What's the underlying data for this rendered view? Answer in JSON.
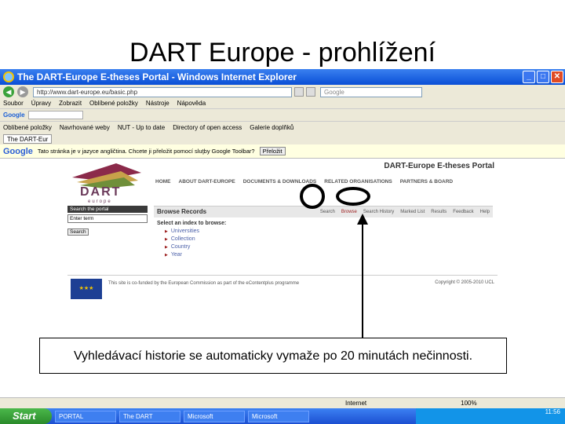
{
  "slide": {
    "title": "DART Europe - prohlížení"
  },
  "browser": {
    "window_title": "The DART-Europe E-theses Portal - Windows Internet Explorer",
    "address": "http://www.dart-europe.eu/basic.php",
    "search_placeholder": "Google",
    "menu": [
      "Soubor",
      "Úpravy",
      "Zobrazit",
      "Oblíbené položky",
      "Nástroje",
      "Nápověda"
    ],
    "google_label": "Google",
    "favorites": [
      "Oblíbené položky",
      "Navrhované weby",
      "NUT - Up to date",
      "Directory of open access",
      "Galerie doplňků"
    ],
    "tab_label": "The DART-Eur",
    "translate_text": "Tato stránka je v jazyce angličtina. Chcete ji přeložit pomocí sluţby Google Toolbar?",
    "translate_button": "Přeložit",
    "google_bar_text": "Google",
    "status_text": "Internet",
    "zoom": "100%"
  },
  "portal": {
    "logo_text": "DART",
    "logo_sub": "europe",
    "title": "DART-Europe E-theses Portal",
    "topnav": [
      "HOME",
      "ABOUT DART-EUROPE",
      "DOCUMENTS & DOWNLOADS",
      "RELATED ORGANISATIONS",
      "PARTNERS & BOARD"
    ],
    "search_head": "Search the portal",
    "search_value": "Enter term",
    "search_button": "Search",
    "browse_title": "Browse Records",
    "subnav": [
      "Search",
      "Browse",
      "Search History",
      "Marked List",
      "Results",
      "Feedback",
      "Help"
    ],
    "select_label": "Select an index to browse:",
    "indexes": [
      "Universities",
      "Collection",
      "Country",
      "Year"
    ],
    "footer_text": "This site is co-funded by the European Commission as part of the eContentplus programme",
    "copyright": "Copyright © 2005-2010 UCL"
  },
  "callout": {
    "text": "Vyhledávací historie se automaticky vymaže po 20 minutách nečinnosti."
  },
  "taskbar": {
    "start": "Start",
    "tasks": [
      "PORTAL",
      "The DART",
      "Microsoft",
      "Microsoft"
    ],
    "clock": "11:56"
  }
}
